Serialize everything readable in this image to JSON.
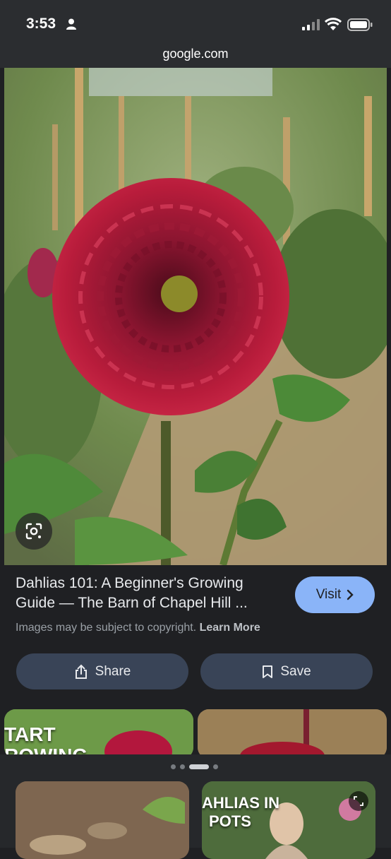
{
  "status": {
    "time": "3:53"
  },
  "browser": {
    "url": "google.com"
  },
  "result": {
    "title": "Dahlias 101: A Beginner's Growing Guide — The Barn of Chapel Hill ...",
    "visit_label": "Visit",
    "copyright_text": "Images may be subject to copyright.",
    "learn_more": "Learn More"
  },
  "actions": {
    "share_label": "Share",
    "save_label": "Save"
  },
  "related": {
    "thumb1_text_line1": "TART",
    "thumb1_text_line2": "ROWING",
    "thumb4_text_line1": "AHLIAS IN",
    "thumb4_text_line2": "POTS"
  }
}
